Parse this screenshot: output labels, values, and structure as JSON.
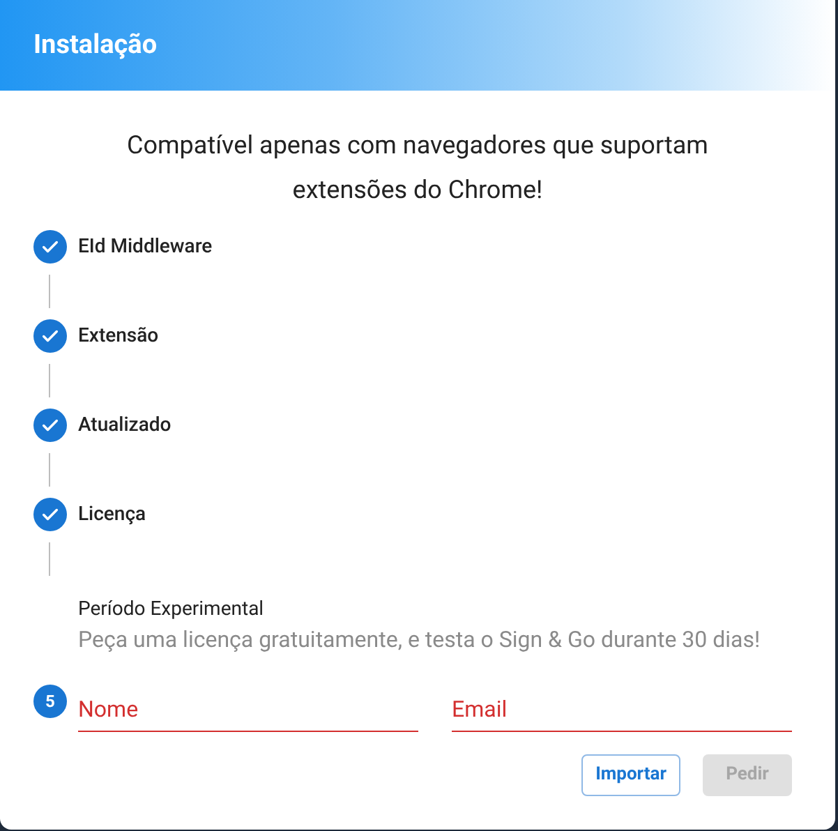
{
  "dialog": {
    "title": "Instalação",
    "subtitle": "Compatível apenas com navegadores que suportam extensões do Chrome!"
  },
  "steps": [
    {
      "label": "EId Middleware",
      "completed": true
    },
    {
      "label": "Extensão",
      "completed": true
    },
    {
      "label": "Atualizado",
      "completed": true
    },
    {
      "label": "Licença",
      "completed": true
    },
    {
      "label": "Período Experimental",
      "completed": false,
      "number": "5",
      "description": "Peça uma licença gratuitamente, e testa o Sign & Go durante 30 dias!",
      "fields": [
        {
          "placeholder": "Nome",
          "error": true
        },
        {
          "placeholder": "Email",
          "error": true
        }
      ],
      "buttons": [
        {
          "label": "Importar",
          "kind": "outlined",
          "disabled": false
        },
        {
          "label": "Pedir",
          "kind": "contained",
          "disabled": true
        }
      ]
    }
  ]
}
